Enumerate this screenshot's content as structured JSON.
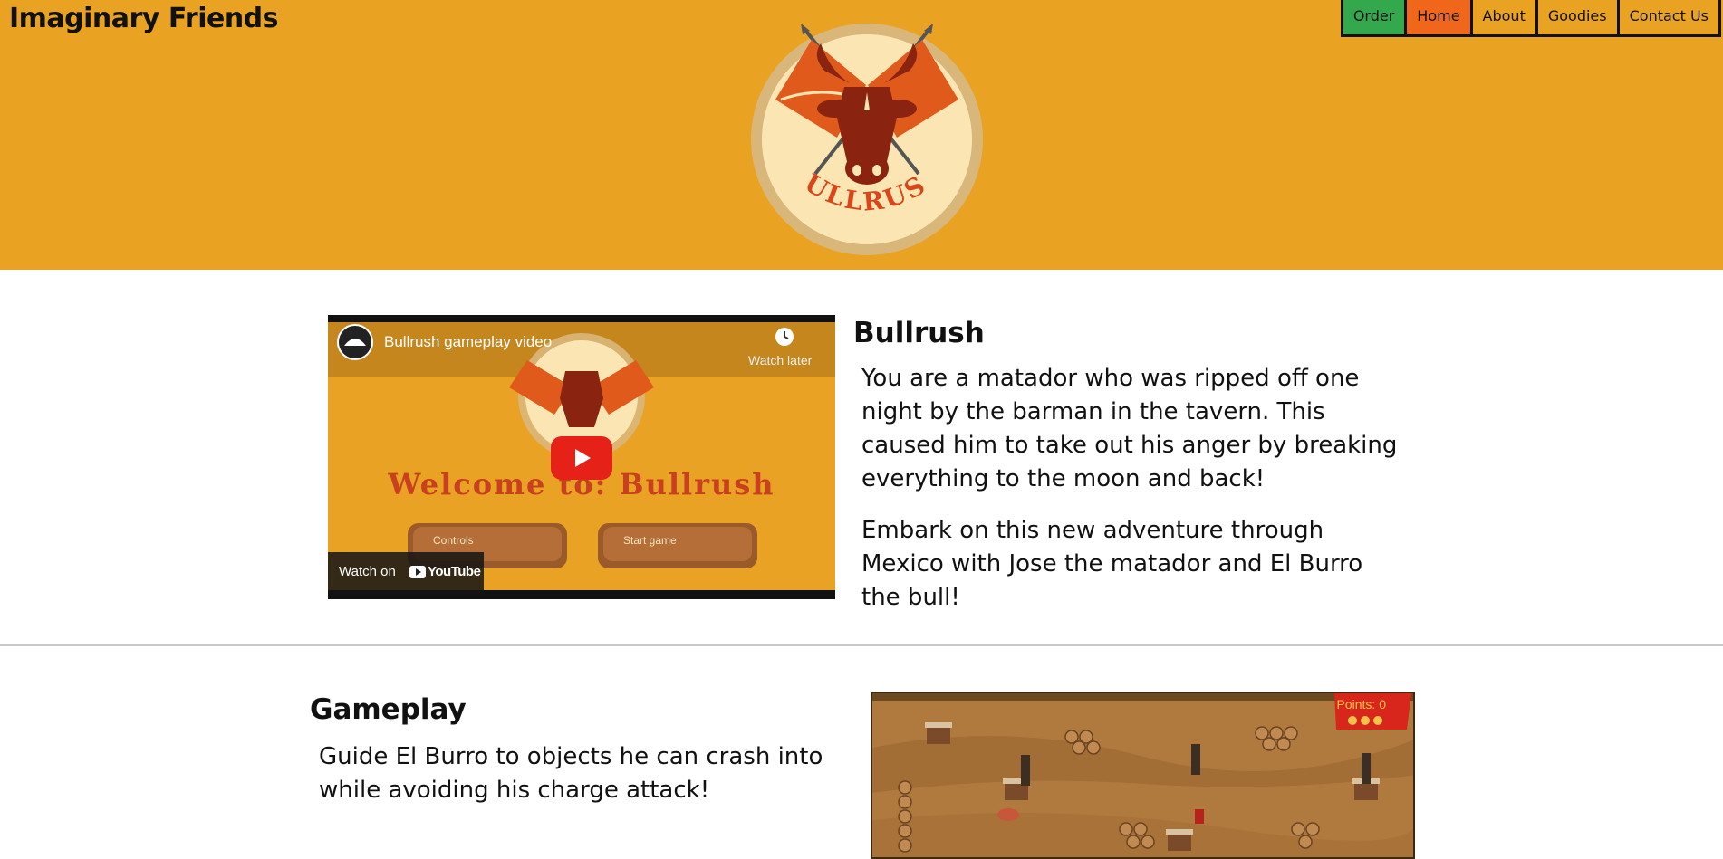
{
  "header": {
    "site_title": "Imaginary Friends",
    "bg_color": "#eaa223",
    "logo_text": "BULLRUSH",
    "nav": [
      {
        "label": "Order",
        "color": "#33a84d"
      },
      {
        "label": "Home",
        "color": "#f0661a"
      },
      {
        "label": "About",
        "color": "#eaa223"
      },
      {
        "label": "Goodies",
        "color": "#eaa223"
      },
      {
        "label": "Contact Us",
        "color": "#eaa223"
      }
    ]
  },
  "intro": {
    "video": {
      "title": "Bullrush gameplay video",
      "watch_later": "Watch later",
      "watch_on": "Watch on",
      "brand": "YouTube",
      "welcome": "Welcome to: Bullrush",
      "button_controls": "Controls",
      "button_start": "Start game"
    },
    "heading": "Bullrush",
    "paragraphs": [
      "You are a matador who was ripped off one night by the barman in the tavern. This caused him to take out his anger by breaking everything to the moon and back!",
      "Embark on this new adventure through Mexico with Jose the matador and El Burro the bull!"
    ]
  },
  "gameplay": {
    "heading": "Gameplay",
    "text": "Guide El Burro to objects he can crash into while avoiding his charge attack!",
    "points_label": "Points: 0"
  }
}
